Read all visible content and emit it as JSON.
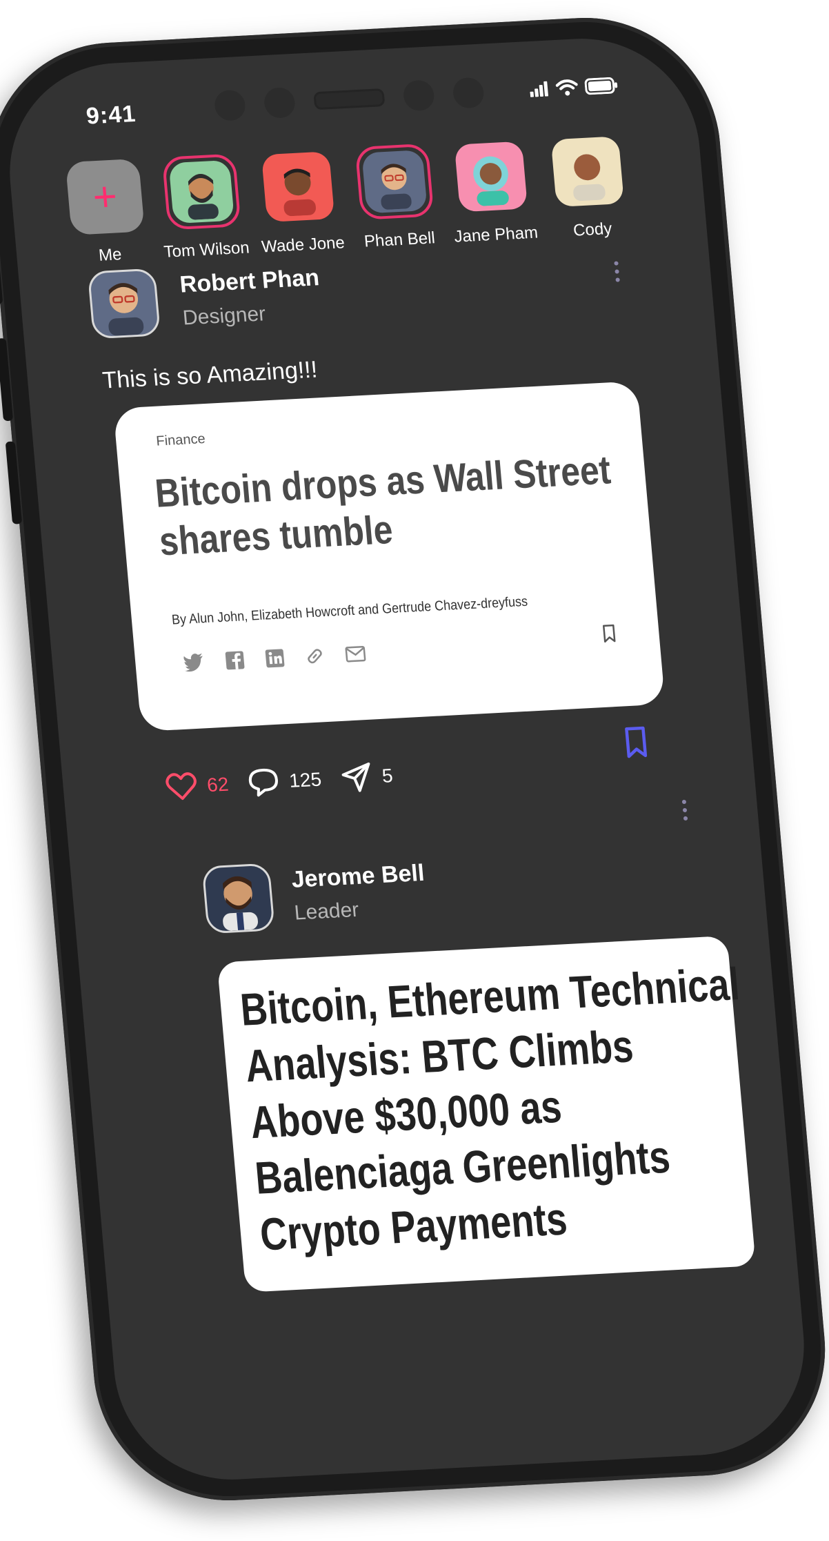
{
  "status_bar": {
    "time": "9:41"
  },
  "stories": [
    {
      "name": "Me",
      "is_add": true,
      "add_glyph": "+",
      "bg": "#8d8d8d"
    },
    {
      "name": "Tom Wilson",
      "bg": "#8fcf9f",
      "ring": true
    },
    {
      "name": "Wade Jone",
      "bg": "#f25a54",
      "ring": false
    },
    {
      "name": "Phan Bell",
      "bg": "#5f6b86",
      "ring": true
    },
    {
      "name": "Jane Pham",
      "bg": "#f78fb0",
      "ring": false
    },
    {
      "name": "Cody",
      "bg": "#efe2bf",
      "ring": false
    }
  ],
  "posts": [
    {
      "author": "Robert Phan",
      "role": "Designer",
      "caption": "This is so Amazing!!!",
      "card": {
        "tag": "Finance",
        "headline": "Bitcoin drops as Wall Street shares tumble",
        "byline": "By Alun John, Elizabeth Howcroft and Gertrude Chavez-dreyfuss"
      },
      "likes": "62",
      "comments": "125",
      "shares": "5"
    },
    {
      "author": "Jerome Bell",
      "role": "Leader",
      "card": {
        "headline": "Bitcoin, Ethereum Technical Analysis: BTC Climbs Above $30,000 as Balenciaga Greenlights Crypto Payments"
      }
    }
  ],
  "colors": {
    "screen_bg": "#333333",
    "accent_pink": "#e8336e",
    "like_red": "#ff4d6a",
    "bookmark_purple": "#5b5cf0",
    "more_dots": "#8b86a8"
  },
  "icons": {
    "add": "plus-icon",
    "more": "more-vertical-icon",
    "like": "heart-icon",
    "comment": "comment-icon",
    "share": "send-icon",
    "bookmark": "bookmark-icon",
    "twitter": "twitter-icon",
    "facebook": "facebook-icon",
    "linkedin": "linkedin-icon",
    "link": "link-icon",
    "mail": "mail-icon"
  }
}
